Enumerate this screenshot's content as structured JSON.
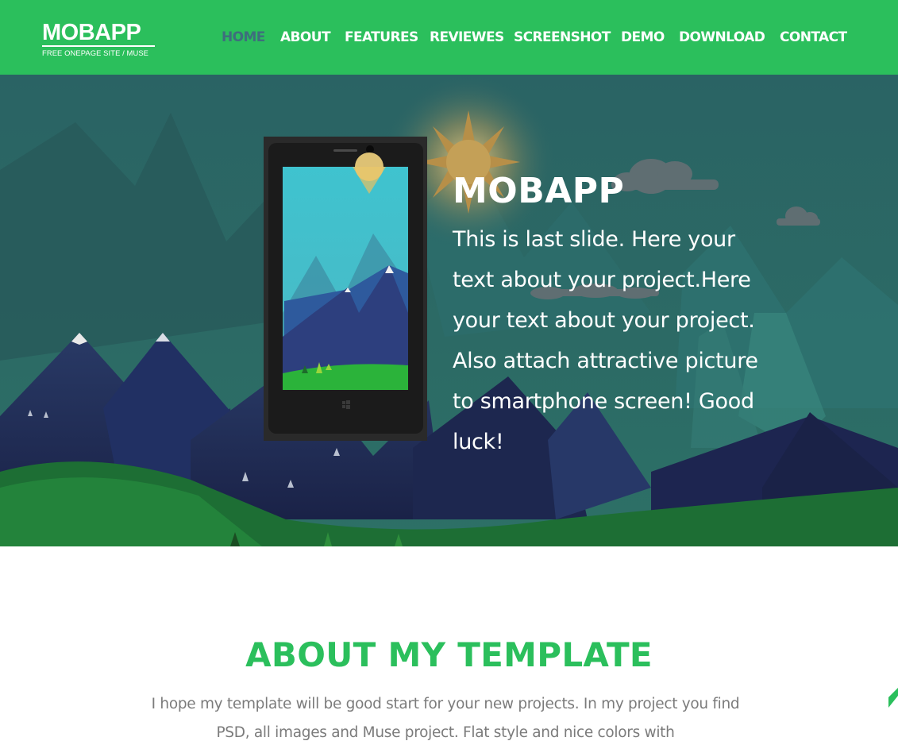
{
  "brand": {
    "title": "MOBAPP",
    "subtitle": "FREE ONEPAGE SITE / MUSE"
  },
  "nav": {
    "items": [
      {
        "label": "HOME",
        "active": true
      },
      {
        "label": "ABOUT"
      },
      {
        "label": "FEATURES"
      },
      {
        "label": "REVIEWES"
      },
      {
        "label": "SCREENSHOT"
      },
      {
        "label": "DEMO"
      },
      {
        "label": "DOWNLOAD"
      },
      {
        "label": "CONTACT"
      }
    ]
  },
  "hero": {
    "title": "MOBAPP",
    "text": "This is last slide. Here your text about your project.Here your text about your project. Also attach attractive picture to smartphone screen! Good luck!"
  },
  "about": {
    "heading": "ABOUT MY TEMPLATE",
    "text": "I hope my template will be good start for your new projects. In my project you find PSD, all images and Muse project. Flat style and nice colors with"
  },
  "colors": {
    "brand_green": "#2bbf5c",
    "nav_active": "#3e6e7d",
    "hero_teal": "#2a6462",
    "mountain_navy": "#1f2a52",
    "body_gray": "#7b7b7b"
  },
  "icons": {
    "phone": "smartphone-illustration",
    "sun": "sun-icon",
    "cloud": "cloud-icon",
    "windows_logo": "windows-logo-icon"
  }
}
